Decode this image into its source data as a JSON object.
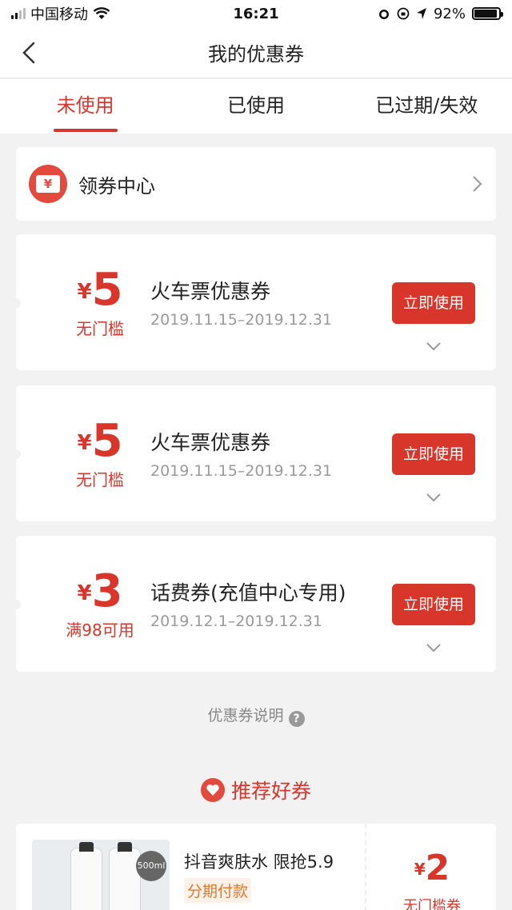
{
  "status_bar": {
    "carrier": "中国移动",
    "time": "16:21",
    "battery": "92%",
    "battery_level": 0.92
  },
  "header": {
    "title": "我的优惠券"
  },
  "tabs": [
    {
      "label": "未使用",
      "active": true
    },
    {
      "label": "已使用",
      "active": false
    },
    {
      "label": "已过期/失效",
      "active": false
    }
  ],
  "coupon_center": {
    "icon_text": "¥",
    "label": "领券中心"
  },
  "coupons": [
    {
      "currency": "¥",
      "amount": "5",
      "condition": "无门槛",
      "title": "火车票优惠券",
      "dates": "2019.11.15–2019.12.31",
      "button": "立即使用"
    },
    {
      "currency": "¥",
      "amount": "5",
      "condition": "无门槛",
      "title": "火车票优惠券",
      "dates": "2019.11.15–2019.12.31",
      "button": "立即使用"
    },
    {
      "currency": "¥",
      "amount": "3",
      "condition": "满98可用",
      "title": "话费券(充值中心专用)",
      "dates": "2019.12.1–2019.12.31",
      "button": "立即使用"
    }
  ],
  "explain": {
    "label": "优惠券说明",
    "icon": "?"
  },
  "recommend": {
    "title": "推荐好券",
    "product": {
      "name": "抖音爽肤水 限抢5.9",
      "tag": "分期付款",
      "badge": "500ml",
      "currency": "¥",
      "amount": "2",
      "condition": "无门槛券"
    }
  },
  "colors": {
    "accent": "#d9362b",
    "background": "#f2f2f2"
  }
}
